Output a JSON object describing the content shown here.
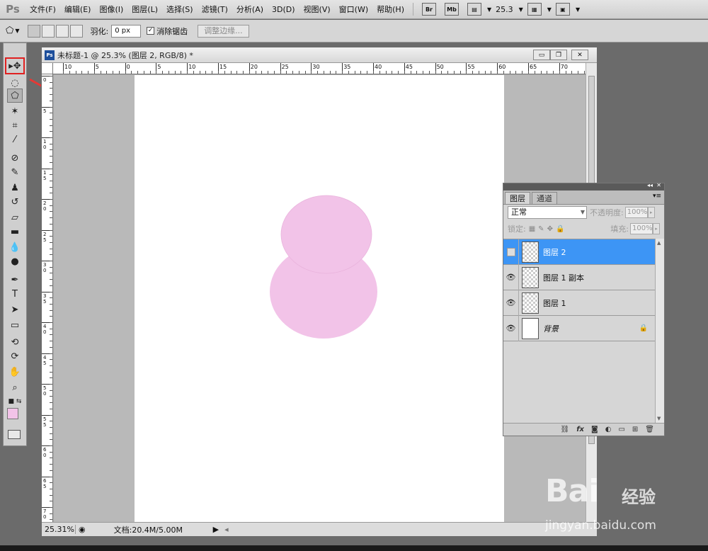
{
  "menubar": {
    "logo": "Ps",
    "items": [
      "文件(F)",
      "编辑(E)",
      "图像(I)",
      "图层(L)",
      "选择(S)",
      "滤镜(T)",
      "分析(A)",
      "3D(D)",
      "视图(V)",
      "窗口(W)",
      "帮助(H)"
    ],
    "bridge_label": "Br",
    "minibridge_label": "Mb",
    "zoom": "25.3"
  },
  "options": {
    "feather_label": "羽化:",
    "feather_value": "0 px",
    "antialias_label": "消除锯齿",
    "antialias_checked": "✓",
    "refine_edge_label": "调整边缘..."
  },
  "document": {
    "ps_icon": "Ps",
    "title": "未标题-1 @ 25.3% (图层 2, RGB/8) *",
    "zoom_status": "25.31%",
    "doc_size": "文档:20.4M/5.00M",
    "hruler_labels": [
      "10",
      "5",
      "0",
      "5",
      "10",
      "15",
      "20",
      "25",
      "30",
      "35",
      "40",
      "45",
      "50",
      "55",
      "60",
      "65",
      "70"
    ],
    "vruler_labels": [
      "0",
      "5",
      "1 0",
      "1 5",
      "2 0",
      "2 5",
      "3 0",
      "3 5",
      "4 0",
      "4 5",
      "5 0",
      "5 5",
      "6 0",
      "6 5",
      "7 0"
    ],
    "circle_color": "#f2c3e8"
  },
  "layers_panel": {
    "tabs": [
      "图层",
      "通道"
    ],
    "blend_mode": "正常",
    "opacity_label": "不透明度:",
    "opacity_value": "100%",
    "lock_label": "锁定:",
    "fill_label": "填充:",
    "fill_value": "100%",
    "layers": [
      {
        "name": "图层 2",
        "visible": false,
        "selected": true
      },
      {
        "name": "图层 1 副本",
        "visible": true,
        "selected": false
      },
      {
        "name": "图层 1",
        "visible": true,
        "selected": false
      },
      {
        "name": "背景",
        "visible": true,
        "selected": false,
        "locked": true
      }
    ]
  },
  "watermark": {
    "brand": "Bai",
    "brand_suffix": "经验",
    "url": "jingyan.baidu.com"
  },
  "colors": {
    "selected_layer": "#3d95f5",
    "arrow": "#e53935",
    "foreground": "#f2c3e8"
  }
}
